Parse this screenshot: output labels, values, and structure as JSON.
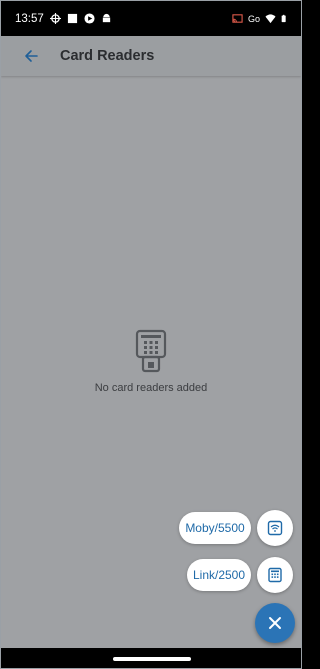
{
  "status_bar": {
    "time": "13:57",
    "left_icons": [
      "crosshair-icon",
      "square-icon",
      "play-icon",
      "android-icon"
    ],
    "right_icons": [
      "cast-icon",
      "go-icon",
      "wifi-icon",
      "battery-icon"
    ],
    "go_label": "Go"
  },
  "app_bar": {
    "title": "Card Readers",
    "back_icon": "arrow-left-icon"
  },
  "empty_state": {
    "icon": "card-reader-icon",
    "message": "No card readers added"
  },
  "speed_dial": {
    "items": [
      {
        "label": "Moby/5500",
        "icon": "wireless-reader-icon"
      },
      {
        "label": "Link/2500",
        "icon": "keypad-reader-icon"
      }
    ],
    "close_icon": "close-icon"
  },
  "colors": {
    "accent": "#2b74b6",
    "link_text": "#1f6aa8",
    "scrim": "#9fa1a4"
  }
}
